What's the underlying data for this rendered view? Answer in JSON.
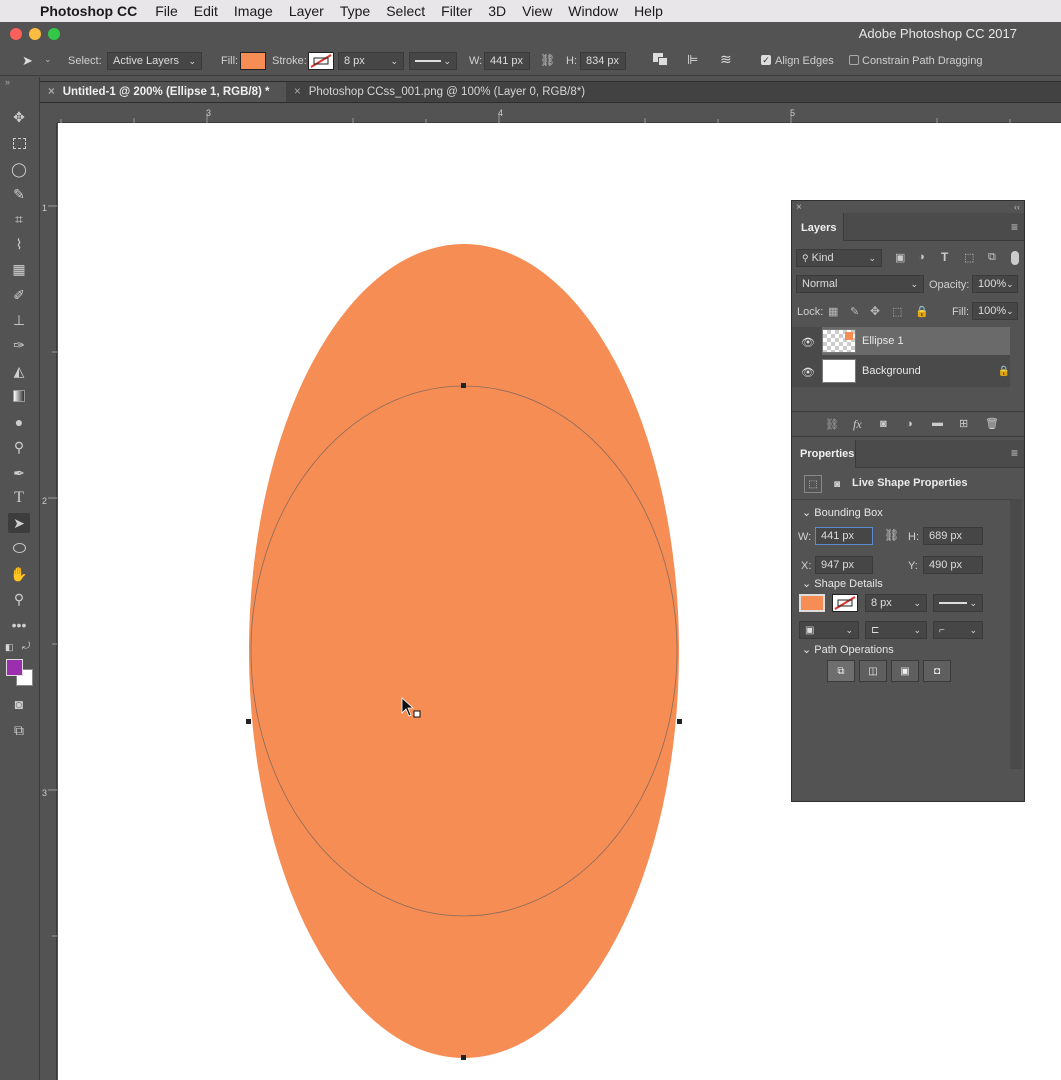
{
  "menubar": {
    "app_name": "Photoshop CC",
    "items": [
      "File",
      "Edit",
      "Image",
      "Layer",
      "Type",
      "Select",
      "Filter",
      "3D",
      "View",
      "Window",
      "Help"
    ]
  },
  "window": {
    "title": "Adobe Photoshop CC 2017"
  },
  "options": {
    "select_label": "Select:",
    "select_value": "Active Layers",
    "fill_label": "Fill:",
    "fill_color": "#f58d55",
    "stroke_label": "Stroke:",
    "stroke_width": "8 px",
    "w_label": "W:",
    "w_value": "441 px",
    "h_label": "H:",
    "h_value": "834 px",
    "align_edges": "Align Edges",
    "constrain": "Constrain Path Dragging"
  },
  "tabs": [
    {
      "label": "Untitled-1 @ 200% (Ellipse 1, RGB/8) *",
      "active": true
    },
    {
      "label": "Photoshop CCss_001.png @ 100% (Layer 0, RGB/8*)",
      "active": false
    }
  ],
  "ruler": {
    "top": [
      "3",
      "4",
      "5"
    ],
    "left": [
      "1",
      "2",
      "3"
    ]
  },
  "colors": {
    "foreground": "#9b2fae",
    "background": "#ffffff",
    "shape": "#f58d55"
  },
  "layers_panel": {
    "title": "Layers",
    "kind": "Kind",
    "blend_mode": "Normal",
    "opacity_label": "Opacity:",
    "opacity_value": "100%",
    "lock_label": "Lock:",
    "fill_label": "Fill:",
    "fill_value": "100%",
    "layers": [
      {
        "name": "Ellipse 1",
        "selected": true
      },
      {
        "name": "Background",
        "selected": false
      }
    ]
  },
  "properties_panel": {
    "title": "Properties",
    "subtitle": "Live Shape Properties",
    "bounding_box": "Bounding Box",
    "w_label": "W:",
    "w_value": "441 px",
    "h_label": "H:",
    "h_value": "689 px",
    "x_label": "X:",
    "x_value": "947 px",
    "y_label": "Y:",
    "y_value": "490 px",
    "shape_details": "Shape Details",
    "stroke_width": "8 px",
    "path_operations": "Path Operations"
  }
}
